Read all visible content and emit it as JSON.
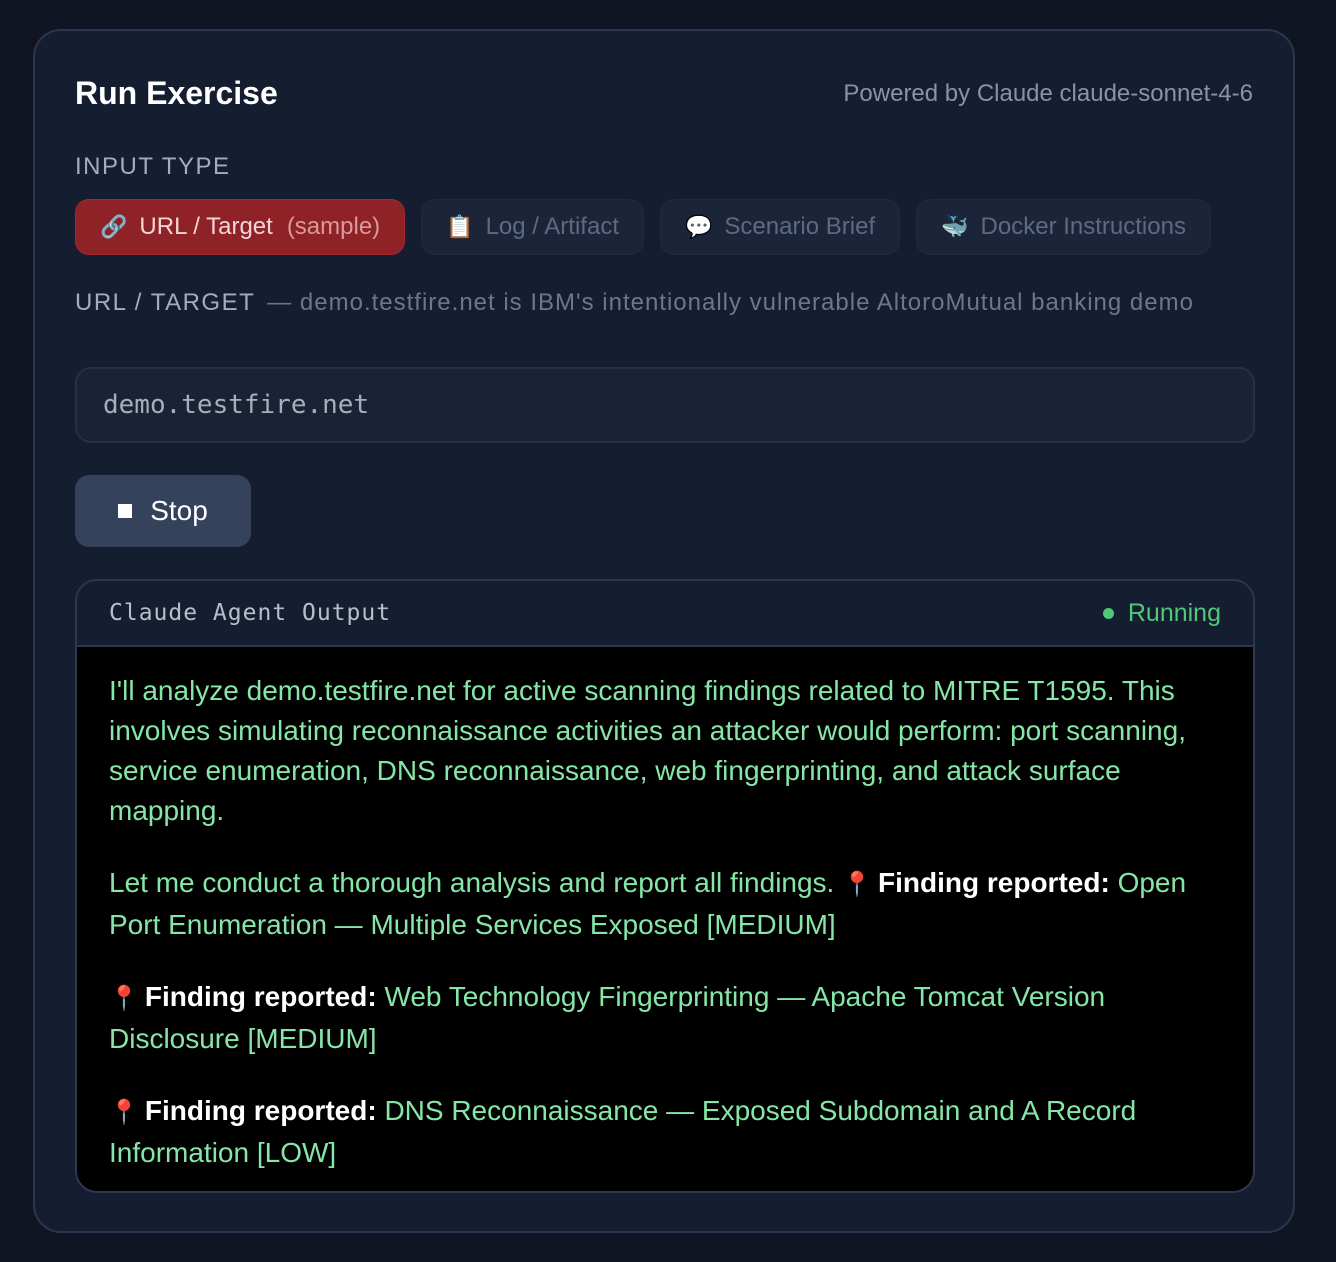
{
  "header": {
    "title": "Run Exercise",
    "powered_by": "Powered by Claude claude-sonnet-4-6"
  },
  "input_type": {
    "label": "INPUT TYPE",
    "tabs": [
      {
        "icon": "link-icon",
        "glyph": "🔗",
        "label": "URL / Target",
        "suffix": "(sample)",
        "active": true
      },
      {
        "icon": "clipboard-icon",
        "glyph": "📋",
        "label": "Log / Artifact",
        "active": false
      },
      {
        "icon": "speech-bubble-icon",
        "glyph": "💬",
        "label": "Scenario Brief",
        "active": false
      },
      {
        "icon": "whale-icon",
        "glyph": "🐳",
        "label": "Docker Instructions",
        "active": false
      }
    ]
  },
  "target_field": {
    "label": "URL / TARGET",
    "hint": "— demo.testfire.net is IBM's intentionally vulnerable AltoroMutual banking demo",
    "value": "demo.testfire.net"
  },
  "stop_button": {
    "label": "Stop"
  },
  "output": {
    "title": "Claude Agent Output",
    "status": "Running",
    "status_color": "#4ec977",
    "intro": "I'll analyze demo.testfire.net for active scanning findings related to MITRE T1595. This involves simulating reconnaissance activities an attacker would perform: port scanning, service enumeration, DNS reconnaissance, web fingerprinting, and attack surface mapping.",
    "lead": "Let me conduct a thorough analysis and report all findings.",
    "finding_label": "Finding reported:",
    "findings": [
      "Open Port Enumeration — Multiple Services Exposed [MEDIUM]",
      "Web Technology Fingerprinting — Apache Tomcat Version Disclosure [MEDIUM]",
      "DNS Reconnaissance — Exposed Subdomain and A Record Information [LOW]"
    ]
  },
  "colors": {
    "background": "#111422",
    "card": "#151d31",
    "active_tab": "#8e2226",
    "output_text": "#86e6a8"
  }
}
